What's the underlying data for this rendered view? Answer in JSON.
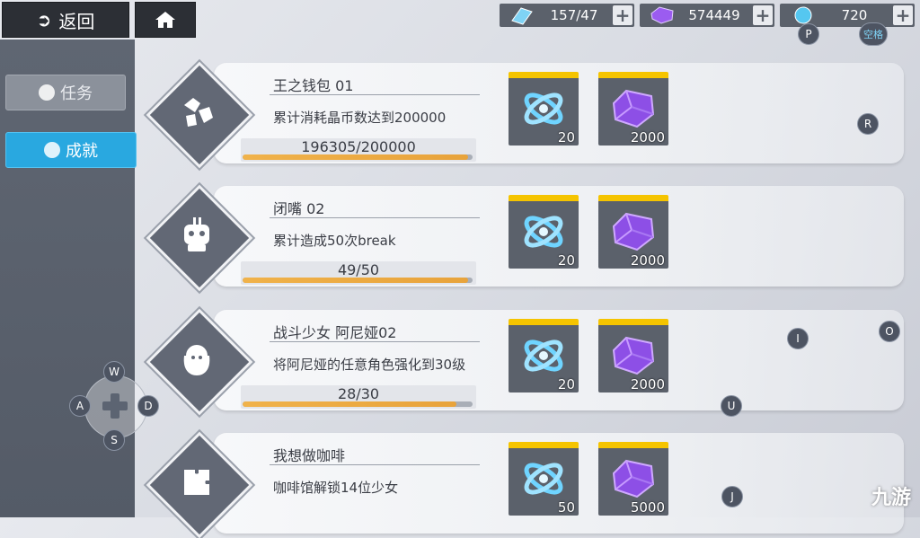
{
  "topbar": {
    "back_label": "返回",
    "stamina": "157/47",
    "crystals": "574449",
    "tickets": "720",
    "space_key": "空格",
    "p_key": "P"
  },
  "tabs": {
    "task_label": "任务",
    "achievement_label": "成就"
  },
  "side_keys": {
    "r": "R",
    "i": "I",
    "o": "O",
    "u": "U",
    "j": "J"
  },
  "dpad": {
    "w": "W",
    "a": "A",
    "s": "S",
    "d": "D"
  },
  "achievements": [
    {
      "title": "王之钱包 01",
      "desc": "累计消耗晶币数达到200000",
      "progress_text": "196305/200000",
      "progress": 0.98,
      "reward1": "20",
      "reward2": "2000",
      "icon": "crystals-icon"
    },
    {
      "title": "闭嘴 02",
      "desc": "累计造成50次break",
      "progress_text": "49/50",
      "progress": 0.98,
      "reward1": "20",
      "reward2": "2000",
      "icon": "robot-icon"
    },
    {
      "title": "战斗少女 阿尼娅02",
      "desc": "将阿尼娅的任意角色强化到30级",
      "progress_text": "28/30",
      "progress": 0.93,
      "reward1": "20",
      "reward2": "2000",
      "icon": "girl-icon"
    },
    {
      "title": "我想做咖啡",
      "desc": "咖啡馆解锁14位少女",
      "progress_text": "",
      "progress": 0,
      "reward1": "50",
      "reward2": "5000",
      "icon": "puzzle-icon"
    }
  ],
  "watermark": "九游",
  "colors": {
    "accent": "#29a8e0",
    "progress": "#f0b24a",
    "reward_border": "#f5c400"
  }
}
